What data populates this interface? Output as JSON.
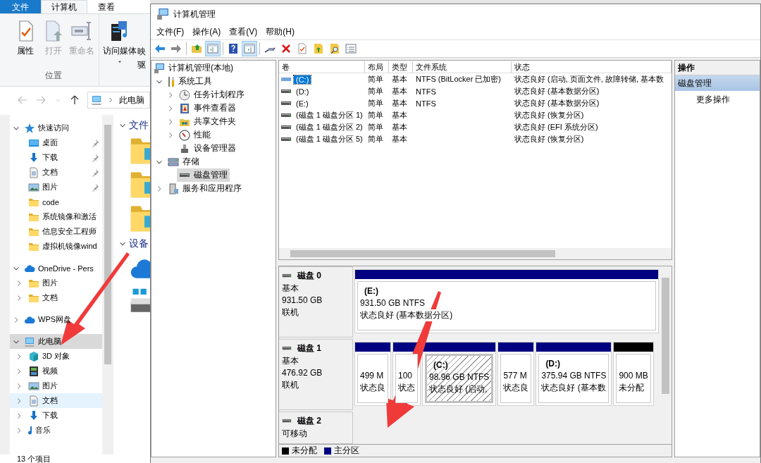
{
  "explorer": {
    "ribbon_tabs": [
      {
        "label": "文件",
        "kind": "file",
        "selected": false
      },
      {
        "label": "计算机",
        "kind": "tab",
        "selected": true
      },
      {
        "label": "查看",
        "kind": "tab",
        "selected": false
      }
    ],
    "ribbon_groups": [
      {
        "label": "位置",
        "buttons": [
          {
            "label": "属性",
            "kind": "properties",
            "disabled": false,
            "dropdown": false
          },
          {
            "label": "打开",
            "kind": "open",
            "disabled": true,
            "dropdown": false
          },
          {
            "label": "重命名",
            "kind": "rename",
            "disabled": true,
            "dropdown": false
          }
        ]
      },
      {
        "buttons": [
          {
            "label": "访问媒体",
            "kind": "media",
            "disabled": false,
            "dropdown": true
          },
          {
            "label": "映驱",
            "kind": "plain",
            "disabled": false,
            "dropdown": false
          }
        ]
      }
    ],
    "address": "此电脑",
    "nav": [
      {
        "label": "快速访问",
        "kind": "star",
        "expanded": true,
        "selected": false,
        "hovered": false,
        "children": [
          {
            "label": "桌面",
            "kind": "desktop",
            "pinned": true,
            "selected": false,
            "hovered": false
          },
          {
            "label": "下载",
            "kind": "download",
            "pinned": true,
            "selected": false,
            "hovered": false
          },
          {
            "label": "文档",
            "kind": "doc",
            "pinned": true,
            "selected": false,
            "hovered": false
          },
          {
            "label": "图片",
            "kind": "picture",
            "pinned": true,
            "selected": false,
            "hovered": false
          },
          {
            "label": "code",
            "kind": "folder",
            "pinned": false,
            "selected": false,
            "hovered": false
          },
          {
            "label": "系统镜像和激活",
            "kind": "folder",
            "pinned": false,
            "selected": false,
            "hovered": false
          },
          {
            "label": "信息安全工程师",
            "kind": "folder",
            "pinned": false,
            "selected": false,
            "hovered": false
          },
          {
            "label": "虚拟机镜像wind",
            "kind": "folder",
            "pinned": false,
            "selected": false,
            "hovered": false
          }
        ]
      },
      {
        "label": "OneDrive - Pers",
        "kind": "cloud",
        "expanded": true,
        "selected": false,
        "hovered": false,
        "children": [
          {
            "label": "图片",
            "kind": "folder",
            "expanded": false,
            "selected": false,
            "hovered": false
          },
          {
            "label": "文档",
            "kind": "folder",
            "expanded": false,
            "selected": false,
            "hovered": false
          }
        ]
      },
      {
        "label": "WPS网盘",
        "kind": "cloud",
        "expanded": false,
        "selected": false,
        "hovered": false
      },
      {
        "label": "此电脑",
        "kind": "pc",
        "expanded": true,
        "selected": true,
        "hovered": false,
        "children": [
          {
            "label": "3D 对象",
            "kind": "cube",
            "expanded": false,
            "selected": false,
            "hovered": false
          },
          {
            "label": "视频",
            "kind": "video",
            "expanded": false,
            "selected": false,
            "hovered": false
          },
          {
            "label": "图片",
            "kind": "picture",
            "expanded": false,
            "selected": false,
            "hovered": false
          },
          {
            "label": "文档",
            "kind": "doc",
            "expanded": false,
            "selected": false,
            "hovered": true
          },
          {
            "label": "下载",
            "kind": "download",
            "expanded": false,
            "selected": false,
            "hovered": false
          },
          {
            "label": "音乐",
            "kind": "music",
            "expanded": false,
            "selected": false,
            "hovered": false
          }
        ]
      }
    ],
    "content_sections": [
      {
        "title": "文件",
        "items": [
          {
            "kind": "folder"
          },
          {
            "kind": "folder"
          },
          {
            "kind": "folder"
          }
        ]
      },
      {
        "title": "设备",
        "items": [
          {
            "kind": "cloud"
          },
          {
            "kind": "drive"
          }
        ]
      }
    ],
    "status": "13 个项目"
  },
  "window": {
    "title": "计算机管理",
    "menu": [
      "文件(F)",
      "操作(A)",
      "查看(V)",
      "帮助(H)"
    ],
    "toolbar": [
      {
        "kind": "back",
        "pressed": false
      },
      {
        "kind": "forward",
        "pressed": false
      },
      {
        "kind": "separator"
      },
      {
        "kind": "folderup",
        "pressed": false
      },
      {
        "kind": "pane",
        "pressed": true
      },
      {
        "kind": "separator"
      },
      {
        "kind": "help",
        "pressed": false
      },
      {
        "kind": "pane2",
        "pressed": true
      },
      {
        "kind": "separator"
      },
      {
        "kind": "connect",
        "pressed": false
      },
      {
        "kind": "delete",
        "pressed": false
      },
      {
        "kind": "props",
        "pressed": false
      },
      {
        "kind": "folderarrow",
        "pressed": false
      },
      {
        "kind": "foldersearch",
        "pressed": false
      },
      {
        "kind": "list",
        "pressed": false
      }
    ],
    "tree": [
      {
        "label": "计算机管理(本地)",
        "kind": "mgmt",
        "selected": false,
        "children": [
          {
            "label": "系统工具",
            "kind": "tools",
            "expanded": true,
            "selected": false,
            "children": [
              {
                "label": "任务计划程序",
                "kind": "clock",
                "expanded": false,
                "selected": false
              },
              {
                "label": "事件查看器",
                "kind": "event",
                "expanded": false,
                "selected": false
              },
              {
                "label": "共享文件夹",
                "kind": "share",
                "expanded": false,
                "selected": false
              },
              {
                "label": "性能",
                "kind": "perf",
                "expanded": false,
                "selected": false
              },
              {
                "label": "设备管理器",
                "kind": "devmgr",
                "selected": false
              }
            ]
          },
          {
            "label": "存储",
            "kind": "storage",
            "expanded": true,
            "selected": false,
            "children": [
              {
                "label": "磁盘管理",
                "kind": "disk",
                "selected": true
              }
            ]
          },
          {
            "label": "服务和应用程序",
            "kind": "services",
            "expanded": false,
            "selected": false
          }
        ]
      }
    ],
    "volumes": {
      "columns": [
        "卷",
        "布局",
        "类型",
        "文件系统",
        "状态"
      ],
      "rows": [
        {
          "volume": "(C:)",
          "kind": "encrypted",
          "layout": "简单",
          "type": "基本",
          "filesystem": "NTFS (BitLocker 已加密)",
          "status": "状态良好 (启动, 页面文件, 故障转储, 基本数",
          "selected": true
        },
        {
          "volume": "(D:)",
          "kind": "disk",
          "layout": "简单",
          "type": "基本",
          "filesystem": "NTFS",
          "status": "状态良好 (基本数据分区)",
          "selected": false
        },
        {
          "volume": "(E:)",
          "kind": "disk",
          "layout": "简单",
          "type": "基本",
          "filesystem": "NTFS",
          "status": "状态良好 (基本数据分区)",
          "selected": false
        },
        {
          "volume": "(磁盘 1 磁盘分区 1)",
          "kind": "disk",
          "layout": "简单",
          "type": "基本",
          "status": "状态良好 (恢复分区)",
          "selected": false
        },
        {
          "volume": "(磁盘 1 磁盘分区 2)",
          "kind": "disk",
          "layout": "简单",
          "type": "基本",
          "status": "状态良好 (EFI 系统分区)",
          "selected": false
        },
        {
          "volume": "(磁盘 1 磁盘分区 5)",
          "kind": "disk",
          "layout": "简单",
          "type": "基本",
          "status": "状态良好 (恢复分区)",
          "selected": false
        }
      ]
    },
    "disks": [
      {
        "name": "磁盘 0",
        "type": "基本",
        "size": "931.50 GB",
        "state": "联机",
        "partitions": [
          {
            "label": "(E:)",
            "size": "931.50 GB NTFS",
            "status": "状态良好 (基本数据分区)",
            "kind": "primary",
            "selected": false
          }
        ]
      },
      {
        "name": "磁盘 1",
        "type": "基本",
        "size": "476.92 GB",
        "state": "联机",
        "partitions": [
          {
            "size": "499 M",
            "status": "状态良",
            "kind": "primary",
            "selected": false
          },
          {
            "size": "100",
            "status": "状态",
            "kind": "primary",
            "selected": false
          },
          {
            "label": "(C:)",
            "size": "98.96 GB NTFS",
            "status": "状态良好 (启动,",
            "kind": "primary",
            "selected": true
          },
          {
            "size": "577 M",
            "status": "状态良",
            "kind": "primary",
            "selected": false
          },
          {
            "label": "(D:)",
            "size": "375.94 GB NTFS",
            "status": "状态良好 (基本数",
            "kind": "primary",
            "selected": false
          },
          {
            "size": "900 MB",
            "status": "未分配",
            "kind": "unallocated",
            "selected": false
          }
        ]
      },
      {
        "name": "磁盘 2",
        "type": "可移动"
      }
    ],
    "legend": [
      {
        "label": "未分配",
        "color": "#000000"
      },
      {
        "label": "主分区",
        "color": "#000080"
      }
    ],
    "actions": [
      {
        "label": "操作",
        "kind": "header"
      },
      {
        "label": "磁盘管理",
        "kind": "section"
      },
      {
        "label": "更多操作",
        "kind": "item"
      }
    ]
  }
}
